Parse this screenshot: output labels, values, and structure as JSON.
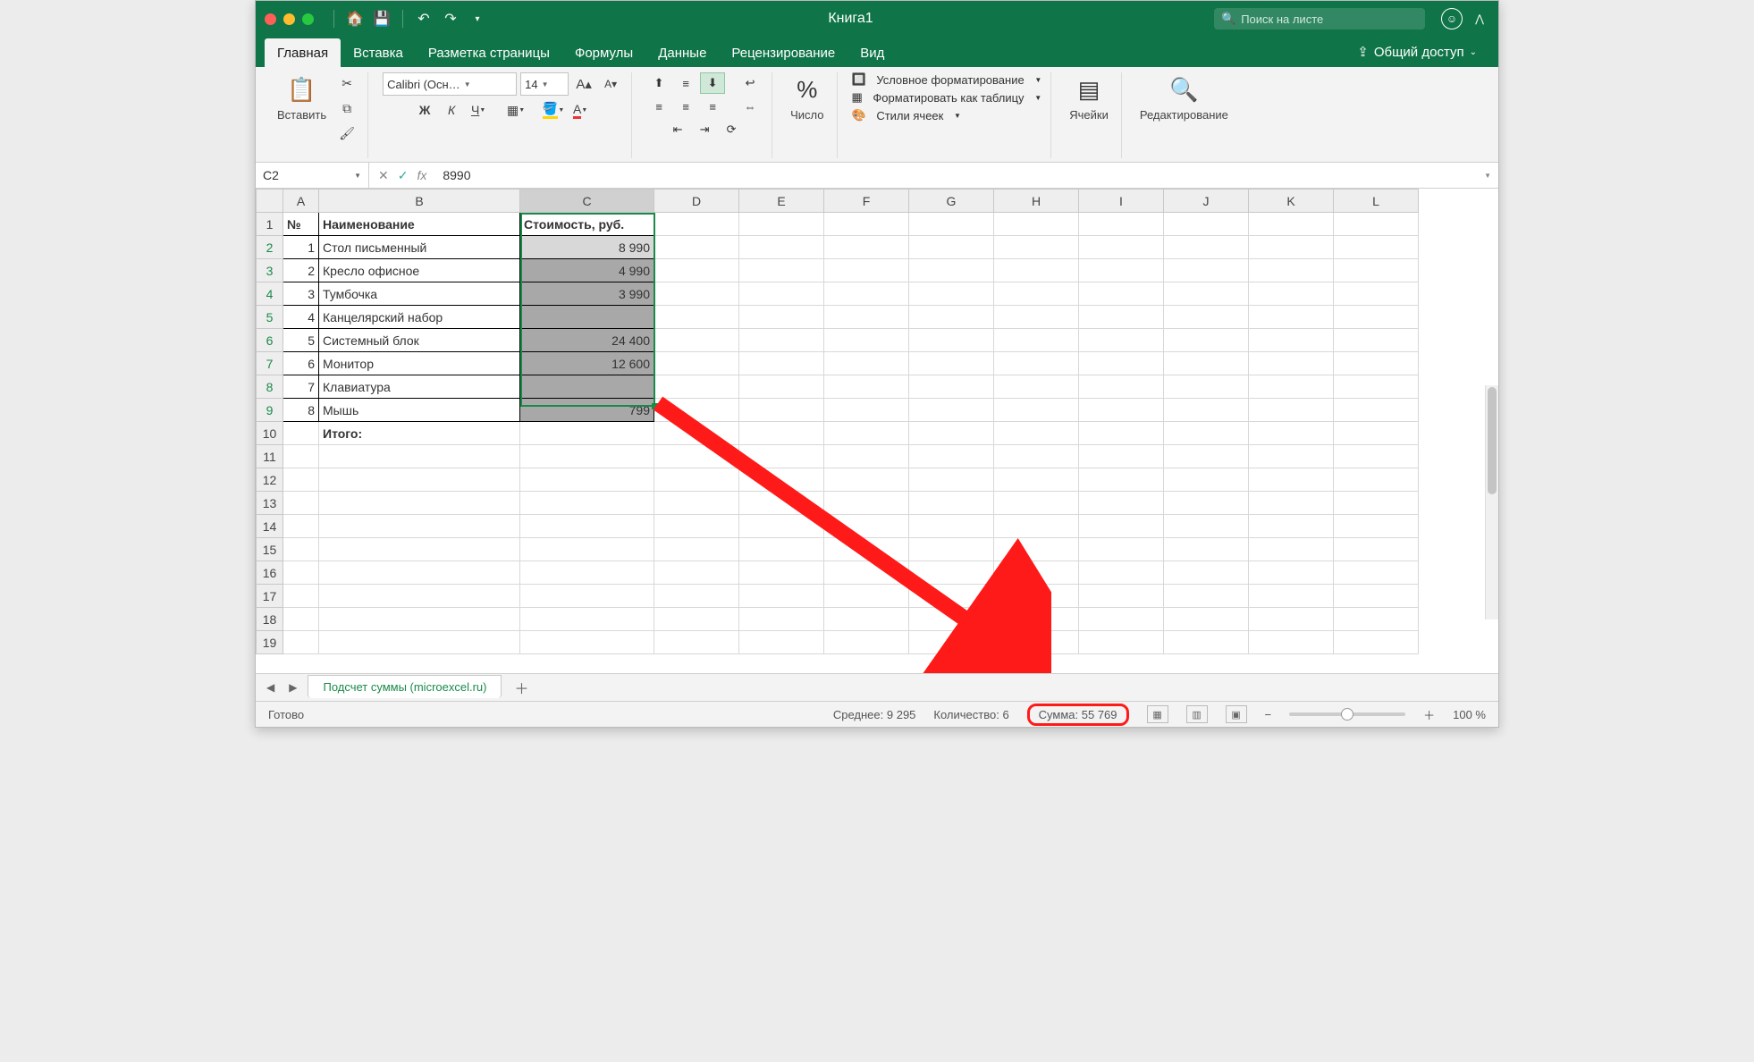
{
  "titlebar": {
    "title": "Книга1",
    "search_placeholder": "Поиск на листе"
  },
  "tabs": {
    "items": [
      "Главная",
      "Вставка",
      "Разметка страницы",
      "Формулы",
      "Данные",
      "Рецензирование",
      "Вид"
    ],
    "active_index": 0,
    "share": "Общий доступ"
  },
  "ribbon": {
    "paste": "Вставить",
    "font_name": "Calibri (Осн…",
    "font_size": "14",
    "increase_font": "A",
    "decrease_font": "A",
    "bold": "Ж",
    "italic": "К",
    "underline": "Ч",
    "number": "Число",
    "cond_format": "Условное форматирование",
    "format_table": "Форматировать как таблицу",
    "cell_styles": "Стили ячеек",
    "cells": "Ячейки",
    "editing": "Редактирование"
  },
  "formula_bar": {
    "cell_ref": "C2",
    "value": "8990"
  },
  "columns": [
    "A",
    "B",
    "C",
    "D",
    "E",
    "F",
    "G",
    "H",
    "I",
    "J",
    "K",
    "L"
  ],
  "headers": {
    "a": "№",
    "b": "Наименование",
    "c": "Стоимость, руб."
  },
  "rows": [
    {
      "n": "1",
      "name": "Стол письменный",
      "cost": "8 990"
    },
    {
      "n": "2",
      "name": "Кресло офисное",
      "cost": "4 990"
    },
    {
      "n": "3",
      "name": "Тумбочка",
      "cost": "3 990"
    },
    {
      "n": "4",
      "name": "Канцелярский набор",
      "cost": ""
    },
    {
      "n": "5",
      "name": "Системный блок",
      "cost": "24 400"
    },
    {
      "n": "6",
      "name": "Монитор",
      "cost": "12 600"
    },
    {
      "n": "7",
      "name": "Клавиатура",
      "cost": ""
    },
    {
      "n": "8",
      "name": "Мышь",
      "cost": "799"
    }
  ],
  "total_label": "Итого:",
  "sheet_tab": "Подсчет суммы (microexcel.ru)",
  "status": {
    "ready": "Готово",
    "avg": "Среднее: 9 295",
    "count": "Количество: 6",
    "sum": "Сумма: 55 769",
    "zoom": "100 %"
  }
}
